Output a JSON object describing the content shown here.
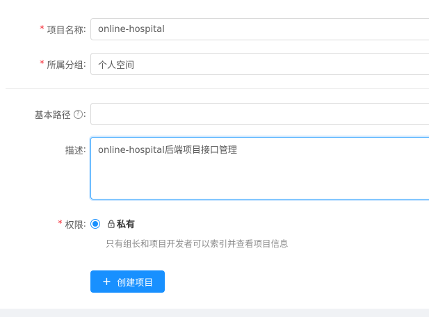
{
  "form": {
    "project_name": {
      "label": "项目名称",
      "required_mark": "*",
      "value": "online-hospital"
    },
    "group": {
      "label": "所属分组",
      "required_mark": "*",
      "value": "个人空间"
    },
    "base_path": {
      "label": "基本路径",
      "help_icon_text": "?",
      "value": ""
    },
    "description": {
      "label": "描述",
      "value": "online-hospital后端项目接口管理"
    },
    "permission": {
      "label": "权限",
      "required_mark": "*",
      "option_label": "私有",
      "option_selected": true,
      "hint": "只有组长和项目开发者可以索引并查看项目信息"
    },
    "label_suffix": ":"
  },
  "actions": {
    "create_button_label": "创建项目",
    "create_button_icon": "plus-icon"
  },
  "colors": {
    "primary": "#1890ff",
    "required": "#f5222d",
    "text": "#595959",
    "muted": "#8c8c8c",
    "border": "#d9d9d9"
  }
}
